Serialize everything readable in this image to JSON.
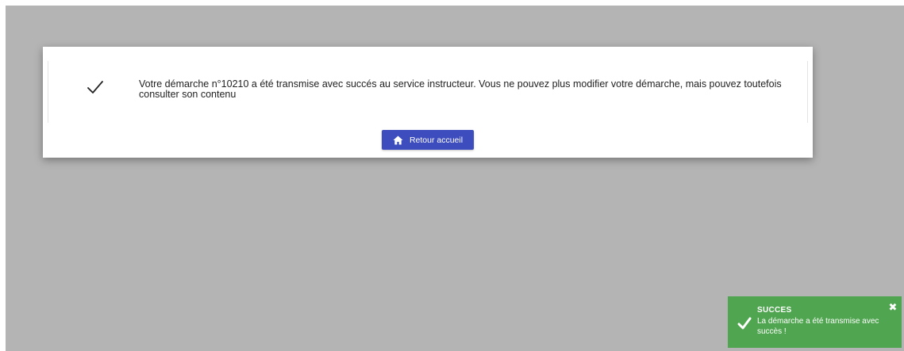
{
  "dialog": {
    "message": "Votre démarche n°10210 a été transmise avec succés au service instructeur. Vous ne pouvez plus modifier votre démarche, mais pouvez toutefois consulter son contenu",
    "icon": "checkmark-icon",
    "button": {
      "label": "Retour accueil",
      "icon": "home-icon",
      "color": "#3d4dbe"
    }
  },
  "toast": {
    "title": "SUCCES",
    "message": "La démarche a été transmise avec succès !",
    "icon": "checkmark-icon",
    "close_icon": "close-icon",
    "color": "#50a550"
  }
}
